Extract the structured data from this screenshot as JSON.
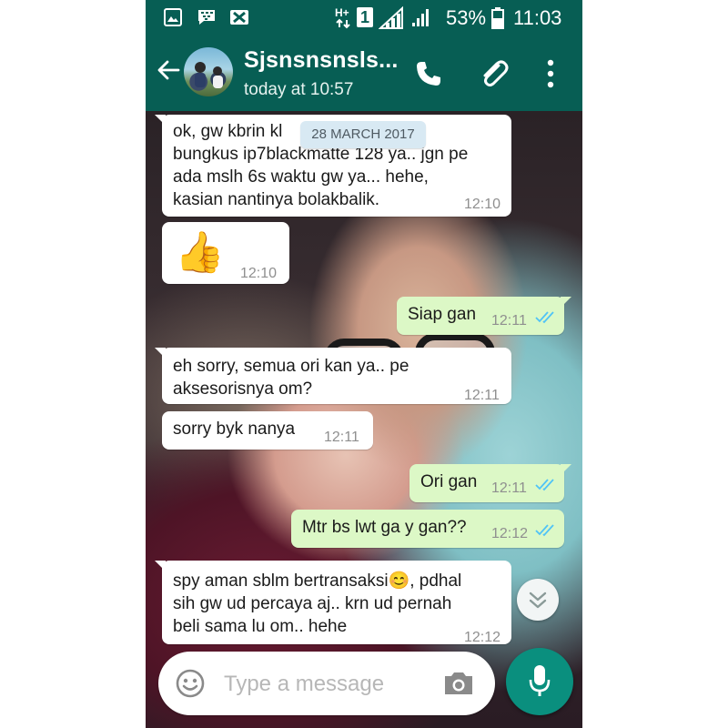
{
  "status_bar": {
    "battery_percent": "53%",
    "time": "11:03",
    "network_badge": "1",
    "icons": [
      "gallery-icon",
      "blackberry-messenger-icon",
      "missed-message-icon",
      "hplus-data-icon",
      "sim-badge-icon",
      "signal-icon",
      "signal-icon-2",
      "battery-icon"
    ]
  },
  "header": {
    "contact_name": "Sjsnsnsnsls...",
    "status": "today at 10:57",
    "icons": [
      "back-arrow-icon",
      "phone-icon",
      "paperclip-icon",
      "more-vert-icon"
    ],
    "color": "#075e54"
  },
  "chat": {
    "date_chip": "28 MARCH 2017",
    "messages": [
      {
        "dir": "in",
        "lines": [
          "ok,  gw kbrin kl",
          "bungkus ip7blackmatte 128 ya.. jgn pe",
          "ada mslh 6s waktu gw ya... hehe,",
          "kasian nantinya bolakbalik."
        ],
        "time": "12:10"
      },
      {
        "dir": "in",
        "emoji": "👍",
        "time": "12:10"
      },
      {
        "dir": "out",
        "lines": [
          "Siap gan"
        ],
        "time": "12:11",
        "read": true
      },
      {
        "dir": "in",
        "lines": [
          "eh sorry,  semua ori kan ya.. pe",
          "aksesorisnya om?"
        ],
        "time": "12:11"
      },
      {
        "dir": "in",
        "lines": [
          "sorry byk nanya"
        ],
        "time": "12:11"
      },
      {
        "dir": "out",
        "lines": [
          "Ori gan"
        ],
        "time": "12:11",
        "read": true
      },
      {
        "dir": "out",
        "lines": [
          "Mtr bs lwt ga y gan??"
        ],
        "time": "12:12",
        "read": true
      },
      {
        "dir": "in",
        "lines": [
          "spy aman sblm bertransaksi",
          ", pdhal",
          "sih gw ud percaya aj.. krn ud pernah",
          "beli sama lu om.. hehe"
        ],
        "time": "12:12",
        "emoji": "😊"
      }
    ]
  },
  "input": {
    "placeholder": "Type a message",
    "value": ""
  },
  "colors": {
    "outgoing_bubble": "#dcf8c6",
    "incoming_bubble": "#ffffff",
    "read_ticks": "#4fc3f7",
    "mic_button": "#0a8f7e"
  }
}
